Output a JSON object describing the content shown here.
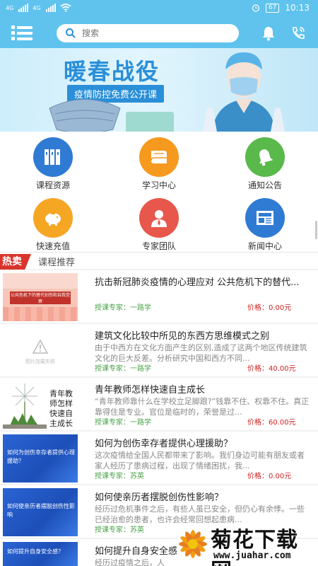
{
  "status_bar": {
    "network_1": "4G",
    "network_2": "4G",
    "battery": "67",
    "time": "10:13"
  },
  "header": {
    "search_placeholder": "搜索",
    "icons": [
      "menu-icon",
      "search-icon",
      "bell-icon",
      "phone-icon"
    ]
  },
  "banner": {
    "title": "暖春战役",
    "subtitle": "疫情防控免费公开课"
  },
  "menu": [
    {
      "label": "课程资源",
      "icon": "books-icon",
      "color": "#2f7bd3"
    },
    {
      "label": "学习中心",
      "icon": "book-icon",
      "color": "#f59a1e"
    },
    {
      "label": "通知公告",
      "icon": "bell-icon",
      "color": "#59b94a"
    },
    {
      "label": "快速充值",
      "icon": "piggy-bank-icon",
      "color": "#f5a623"
    },
    {
      "label": "专家团队",
      "icon": "person-icon",
      "color": "#e8574c"
    },
    {
      "label": "新闻中心",
      "icon": "newspaper-icon",
      "color": "#2f7bd3"
    }
  ],
  "section": {
    "hot_badge": "热卖",
    "title": "课程推荐"
  },
  "courses": [
    {
      "title": "抗击新冠肺炎疫情的心理应对 公共危机下的替代...",
      "desc": "",
      "teacher": "授课专家：一路学",
      "price": "价格：0.00元",
      "thumb_text": "公共危机下的替代创伤和自我觉察"
    },
    {
      "title": "建筑文化比较中所见的东西方思维模式之别",
      "desc": "由于中西方在文化方面产生的区别,造成了这两个地区传统建筑文化的巨大反差。分析研究中国和西方不同...",
      "teacher": "授课专家：一路学",
      "price": "价格：40.00元",
      "thumb_text": "图片加载失败"
    },
    {
      "title": "青年教师怎样快速自主成长",
      "desc": "“青年教师靠什么在学校立足脚跟?”钱靠不住、权靠不住。真正靠得住是专业。官位是临时的，荣誉是过...",
      "teacher": "授课专家：一路学",
      "price": "价格：60.00元",
      "thumb_text": "青年教师怎样快速自主成长"
    },
    {
      "title": "如何为创伤幸存者提供心理援助？",
      "desc": "这次疫情给全国人民都带来了影响。我们身边可能有朋友或者家人经历了患病过程，出现了情绪困扰，我...",
      "teacher": "授课专家：苏英",
      "price": "价格：0.00元",
      "thumb_text": "如何为创伤幸存者提供心理援助？"
    },
    {
      "title": "如何使亲历者摆脱创伤性影响？",
      "desc": "经历过危机事件之后，有些人虽已安全，但仍心有余悸。一些已经治愈的患者，也许会经常回想起患病...",
      "teacher": "授课专家：苏英",
      "price": "",
      "thumb_text": "如何使亲历者摆脱创伤性影响"
    },
    {
      "title": "如何提升自身安全感",
      "desc": "经历过疫情之后，人",
      "teacher": "",
      "price": "",
      "thumb_text": "如何提升自身安全感？"
    }
  ],
  "watermark": {
    "title": "菊花下载网",
    "url": "www.juahar.com"
  }
}
